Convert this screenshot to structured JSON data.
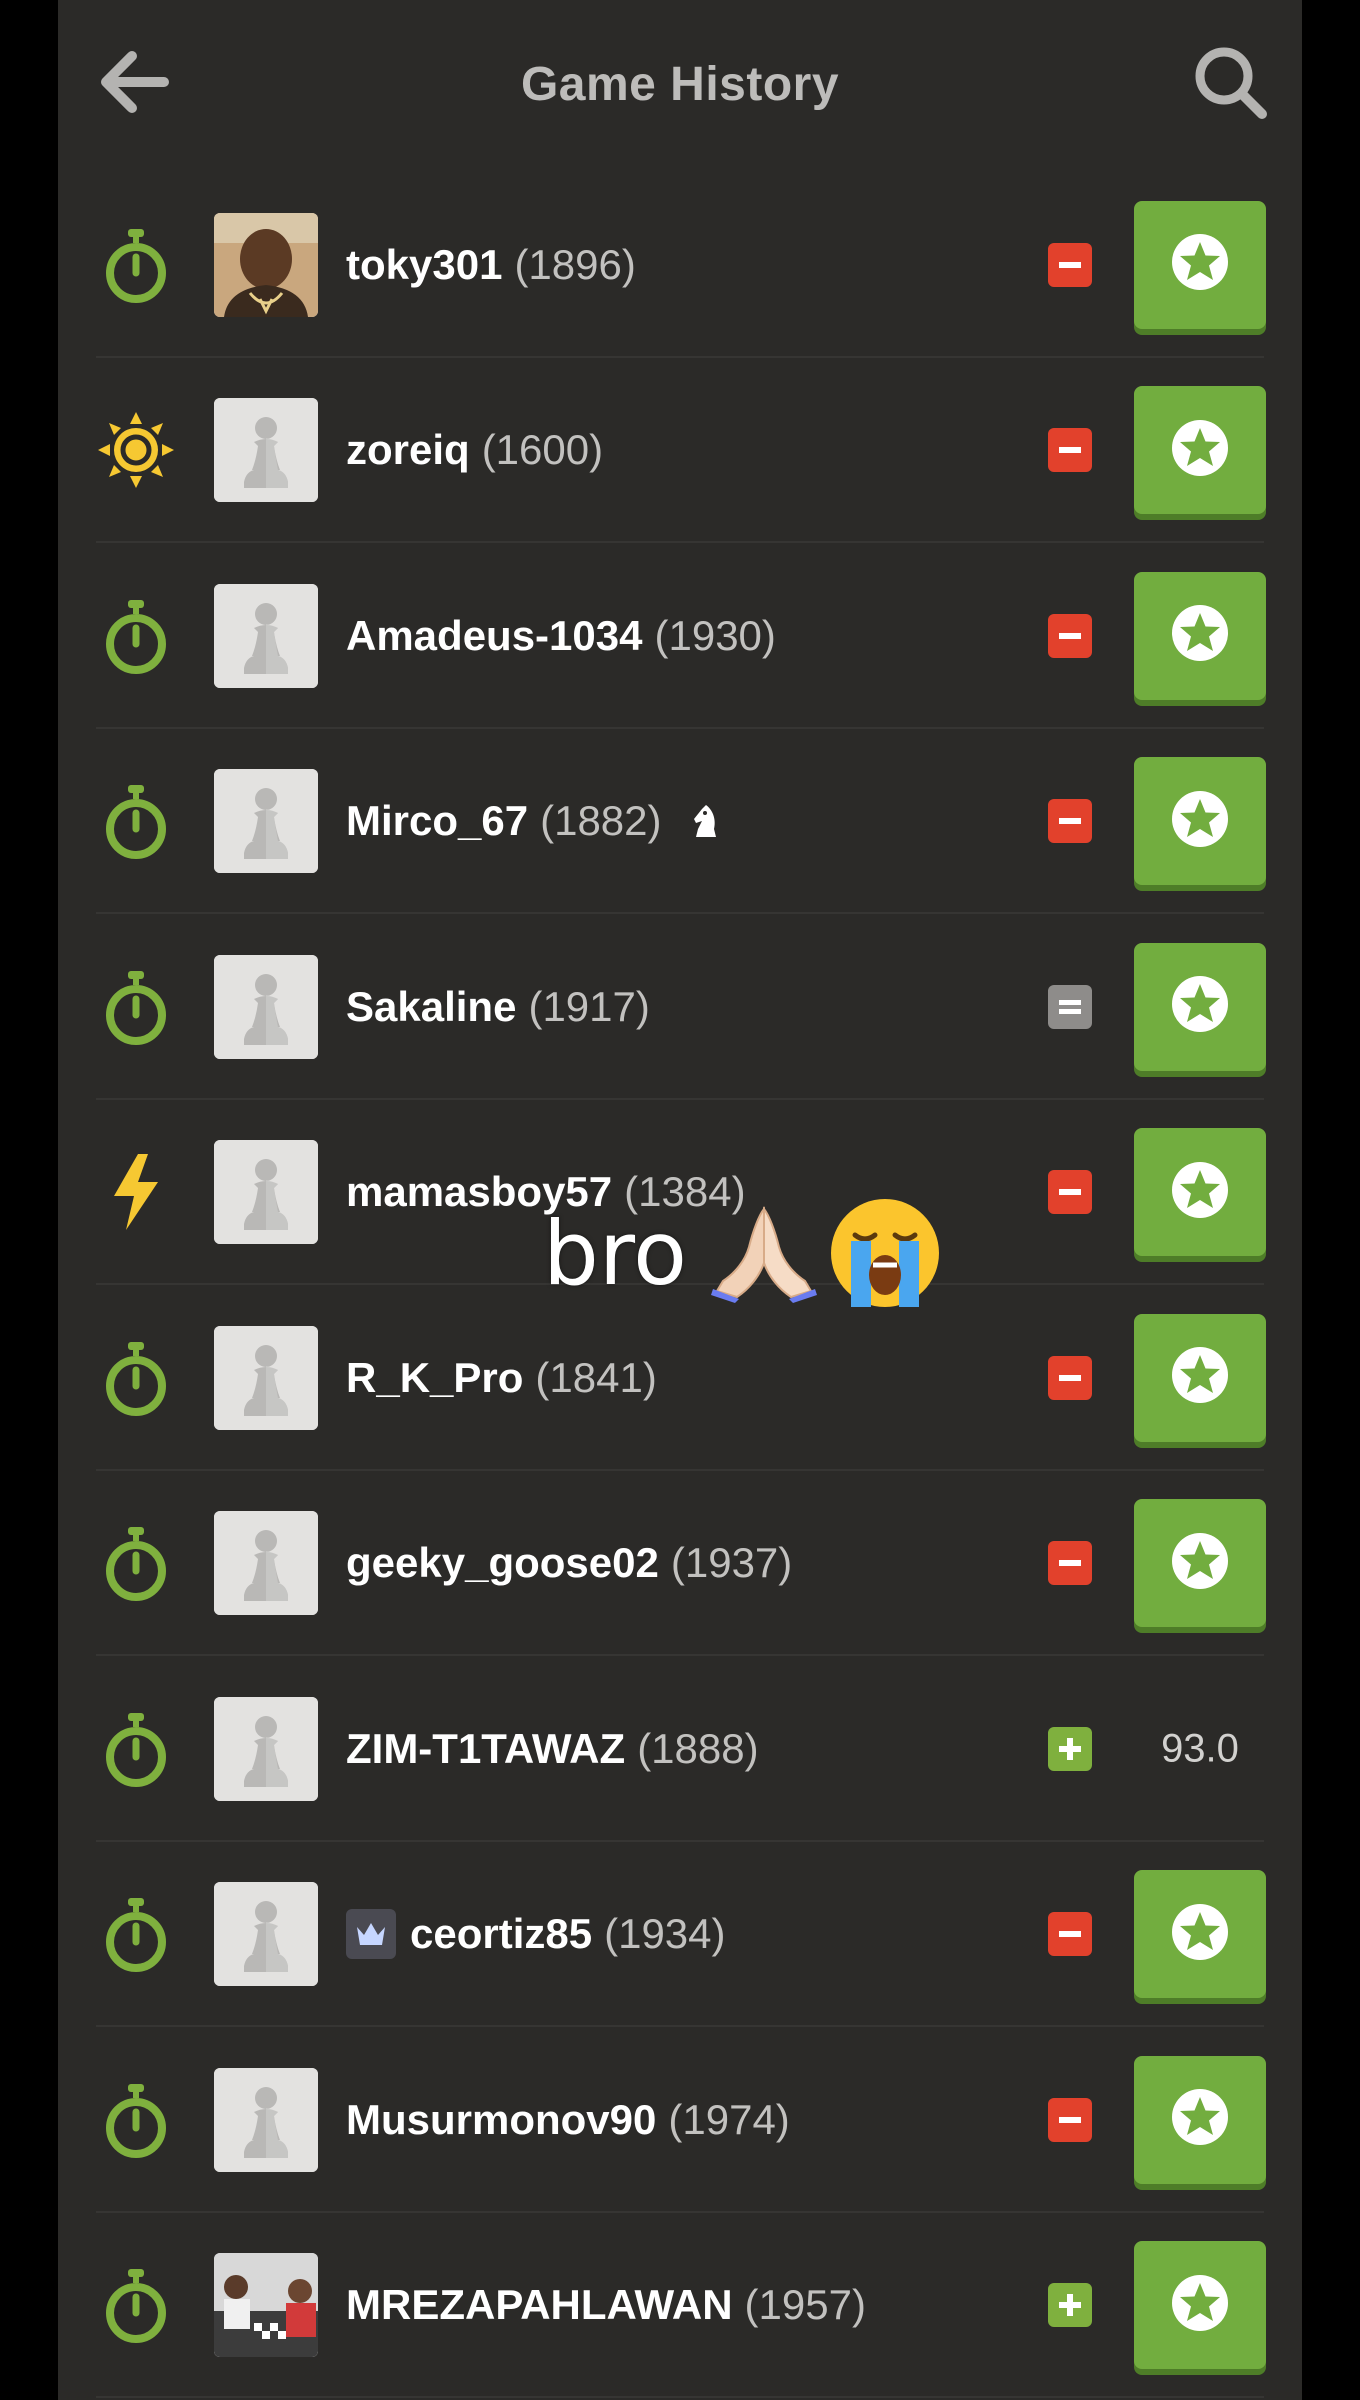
{
  "header": {
    "title": "Game History",
    "back_icon": "arrow-left-icon",
    "search_icon": "search-icon"
  },
  "games": [
    {
      "type": "daily",
      "type_icon": "stopwatch-icon",
      "username": "toky301",
      "rating": "(1896)",
      "result": "loss",
      "avatar": "photo",
      "action": "analyze"
    },
    {
      "type": "blitz",
      "type_icon": "sun-icon",
      "username": "zoreiq",
      "rating": "(1600)",
      "result": "loss",
      "avatar": "pawn",
      "action": "analyze"
    },
    {
      "type": "daily",
      "type_icon": "stopwatch-icon",
      "username": "Amadeus-1034",
      "rating": "(1930)",
      "result": "loss",
      "avatar": "pawn",
      "action": "analyze"
    },
    {
      "type": "daily",
      "type_icon": "stopwatch-icon",
      "username": "Mirco_67",
      "rating": "(1882)",
      "result": "loss",
      "avatar": "pawn",
      "extra_icon": "knight-icon",
      "action": "analyze"
    },
    {
      "type": "daily",
      "type_icon": "stopwatch-icon",
      "username": "Sakaline",
      "rating": "(1917)",
      "result": "draw",
      "avatar": "pawn",
      "action": "analyze"
    },
    {
      "type": "bullet",
      "type_icon": "lightning-icon",
      "username": "mamasboy57",
      "rating": "(1384)",
      "result": "loss",
      "avatar": "pawn",
      "action": "analyze"
    },
    {
      "type": "daily",
      "type_icon": "stopwatch-icon",
      "username": "R_K_Pro",
      "rating": "(1841)",
      "result": "loss",
      "avatar": "pawn",
      "action": "analyze"
    },
    {
      "type": "daily",
      "type_icon": "stopwatch-icon",
      "username": "geeky_goose02",
      "rating": "(1937)",
      "result": "loss",
      "avatar": "pawn",
      "action": "analyze"
    },
    {
      "type": "daily",
      "type_icon": "stopwatch-icon",
      "username": "ZIM-T1TAWAZ",
      "rating": "(1888)",
      "result": "win",
      "avatar": "pawn",
      "action": "accuracy",
      "accuracy": "93.0"
    },
    {
      "type": "daily",
      "type_icon": "stopwatch-icon",
      "username": "ceortiz85",
      "rating": "(1934)",
      "result": "loss",
      "avatar": "pawn",
      "badge_icon": "crown-icon",
      "action": "analyze"
    },
    {
      "type": "daily",
      "type_icon": "stopwatch-icon",
      "username": "Musurmonov90",
      "rating": "(1974)",
      "result": "loss",
      "avatar": "pawn",
      "action": "analyze"
    },
    {
      "type": "daily",
      "type_icon": "stopwatch-icon",
      "username": "MREZAPAHLAWAN",
      "rating": "(1957)",
      "result": "win",
      "avatar": "photo2",
      "action": "analyze"
    }
  ],
  "overlay": {
    "caption": "bro",
    "emoji_icons": [
      "praying-hands-icon",
      "loudly-crying-face-icon"
    ]
  },
  "colors": {
    "background": "#2b2a28",
    "loss": "#e2412c",
    "win": "#7fb03e",
    "draw": "#8e8c8a",
    "analyze_button": "#72ad3f",
    "daily_icon": "#7fb03e",
    "bullet_icon": "#f6c832",
    "blitz_icon": "#f6c832"
  }
}
